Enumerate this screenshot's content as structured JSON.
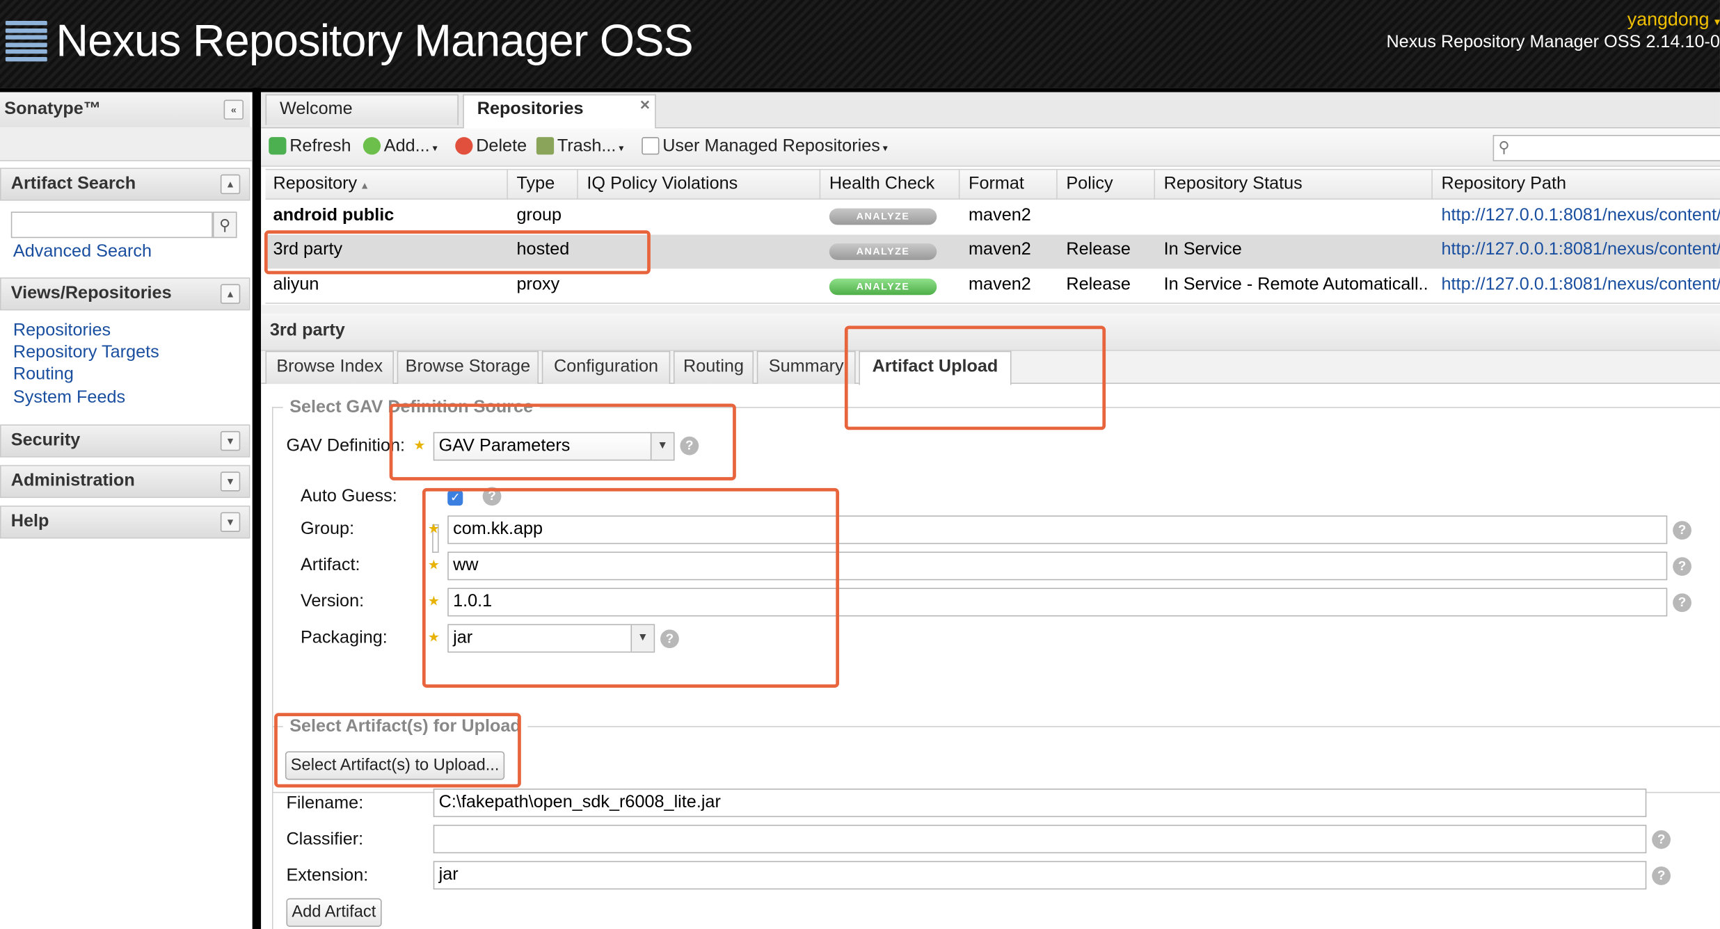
{
  "header": {
    "app_title": "Nexus Repository Manager OSS",
    "user": "yangdong",
    "version": "Nexus Repository Manager OSS 2.14.10-0"
  },
  "sidebar": {
    "brand": "Sonatype™",
    "artifact_search": {
      "title": "Artifact Search",
      "search_placeholder": "",
      "advanced_link": "Advanced Search"
    },
    "views": {
      "title": "Views/Repositories",
      "items": [
        "Repositories",
        "Repository Targets",
        "Routing",
        "System Feeds"
      ]
    },
    "security": "Security",
    "administration": "Administration",
    "help": "Help"
  },
  "tabs": [
    "Welcome",
    "Repositories"
  ],
  "toolbar": {
    "refresh": "Refresh",
    "add": "Add...",
    "delete": "Delete",
    "trash": "Trash...",
    "user_managed": "User Managed Repositories",
    "search_placeholder": ""
  },
  "grid": {
    "columns": [
      "Repository",
      "Type",
      "IQ Policy Violations",
      "Health Check",
      "Format",
      "Policy",
      "Repository Status",
      "Repository Path"
    ],
    "analyze_label": "ANALYZE",
    "rows": [
      {
        "name": "android public",
        "type": "group",
        "iq": "",
        "format": "maven2",
        "policy": "",
        "status": "",
        "path": "http://127.0.0.1:8081/nexus/content/..."
      },
      {
        "name": "3rd party",
        "type": "hosted",
        "iq": "",
        "format": "maven2",
        "policy": "Release",
        "status": "In Service",
        "path": "http://127.0.0.1:8081/nexus/content/..."
      },
      {
        "name": "aliyun",
        "type": "proxy",
        "iq": "",
        "format": "maven2",
        "policy": "Release",
        "status": "In Service - Remote Automaticall...",
        "path": "http://127.0.0.1:8081/nexus/content/..."
      }
    ]
  },
  "detail": {
    "title": "3rd party",
    "tabs": [
      "Browse Index",
      "Browse Storage",
      "Configuration",
      "Routing",
      "Summary",
      "Artifact Upload"
    ],
    "gav_section": {
      "legend": "Select GAV Definition Source",
      "gav_definition_label": "GAV Definition:",
      "gav_definition_value": "GAV Parameters",
      "auto_guess_label": "Auto Guess:",
      "auto_guess_checked": true,
      "group_label": "Group:",
      "group_value": "com.kk.app",
      "artifact_label": "Artifact:",
      "artifact_value": "ww",
      "version_label": "Version:",
      "version_value": "1.0.1",
      "packaging_label": "Packaging:",
      "packaging_value": "jar"
    },
    "upload_section": {
      "legend": "Select Artifact(s) for Upload",
      "select_button": "Select Artifact(s) to Upload...",
      "filename_label": "Filename:",
      "filename_value": "C:\\fakepath\\open_sdk_r6008_lite.jar",
      "classifier_label": "Classifier:",
      "classifier_value": "",
      "extension_label": "Extension:",
      "extension_value": "jar",
      "add_button": "Add Artifact"
    }
  },
  "colors": {
    "annotation": "#e8643c",
    "link": "#1a4fa0",
    "analyze_green": "#5cb85c",
    "analyze_gray": "#a9a9a9",
    "user_name": "#f0c000"
  }
}
